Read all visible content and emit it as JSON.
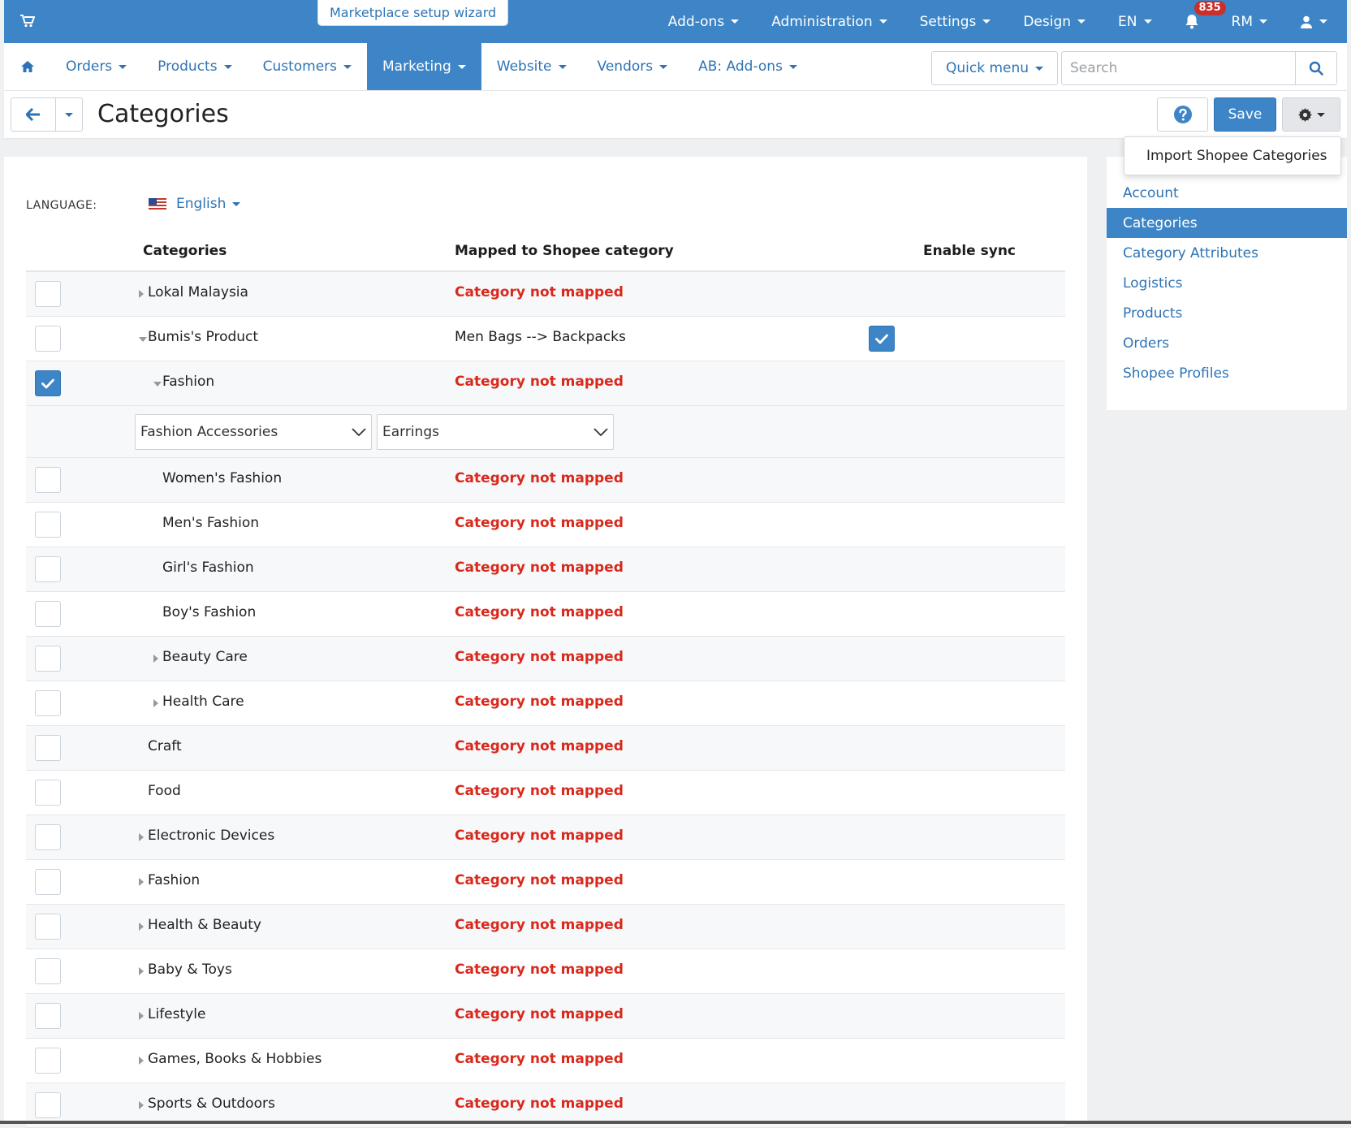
{
  "topbar": {
    "wizard_label": "Marketplace setup wizard",
    "menu": [
      "Add-ons",
      "Administration",
      "Settings",
      "Design",
      "EN"
    ],
    "notification_count": "835",
    "currency": "RM"
  },
  "nav": {
    "items": [
      "Orders",
      "Products",
      "Customers",
      "Marketing",
      "Website",
      "Vendors",
      "AB: Add-ons"
    ],
    "active": "Marketing",
    "quick_menu": "Quick menu",
    "search_placeholder": "Search"
  },
  "header": {
    "title": "Categories",
    "save_label": "Save",
    "dropdown_item": "Import Shopee Categories"
  },
  "language": {
    "label": "LANGUAGE:",
    "value": "English"
  },
  "table": {
    "columns": [
      "Categories",
      "Mapped to Shopee category",
      "Enable sync"
    ],
    "rows": [
      {
        "name": "Lokal Malaysia",
        "mapped": "Category not mapped",
        "level": 0,
        "toggle": "right",
        "checked": false
      },
      {
        "name": "Bumis's Product",
        "mapped": "Men Bags --> Backpacks",
        "level": 0,
        "toggle": "down",
        "checked": false,
        "sync": true
      },
      {
        "name": "Fashion",
        "mapped": "Category not mapped",
        "level": 1,
        "toggle": "down",
        "checked": true
      },
      {
        "name": "Women's Fashion",
        "mapped": "Category not mapped",
        "level": 2,
        "toggle": "none",
        "checked": false
      },
      {
        "name": "Men's Fashion",
        "mapped": "Category not mapped",
        "level": 2,
        "toggle": "none",
        "checked": false
      },
      {
        "name": "Girl's Fashion",
        "mapped": "Category not mapped",
        "level": 2,
        "toggle": "none",
        "checked": false
      },
      {
        "name": "Boy's Fashion",
        "mapped": "Category not mapped",
        "level": 2,
        "toggle": "none",
        "checked": false
      },
      {
        "name": "Beauty Care",
        "mapped": "Category not mapped",
        "level": 1,
        "toggle": "right",
        "checked": false
      },
      {
        "name": "Health Care",
        "mapped": "Category not mapped",
        "level": 1,
        "toggle": "right",
        "checked": false
      },
      {
        "name": "Craft",
        "mapped": "Category not mapped",
        "level": 0,
        "toggle": "none",
        "checked": false
      },
      {
        "name": "Food",
        "mapped": "Category not mapped",
        "level": 0,
        "toggle": "none",
        "checked": false
      },
      {
        "name": "Electronic Devices",
        "mapped": "Category not mapped",
        "level": 0,
        "toggle": "right",
        "checked": false
      },
      {
        "name": "Fashion",
        "mapped": "Category not mapped",
        "level": 0,
        "toggle": "right",
        "checked": false
      },
      {
        "name": "Health & Beauty",
        "mapped": "Category not mapped",
        "level": 0,
        "toggle": "right",
        "checked": false
      },
      {
        "name": "Baby & Toys",
        "mapped": "Category not mapped",
        "level": 0,
        "toggle": "right",
        "checked": false
      },
      {
        "name": "Lifestyle",
        "mapped": "Category not mapped",
        "level": 0,
        "toggle": "right",
        "checked": false
      },
      {
        "name": "Games, Books & Hobbies",
        "mapped": "Category not mapped",
        "level": 0,
        "toggle": "right",
        "checked": false
      },
      {
        "name": "Sports & Outdoors",
        "mapped": "Category not mapped",
        "level": 0,
        "toggle": "right",
        "checked": false
      }
    ],
    "mapping_selects": [
      "Fashion Accessories",
      "Earrings"
    ]
  },
  "sidebar": {
    "items": [
      "Account",
      "Categories",
      "Category Attributes",
      "Logistics",
      "Products",
      "Orders",
      "Shopee Profiles"
    ],
    "active": "Categories"
  },
  "colors": {
    "primary": "#3d85c6",
    "link": "#2e74b5",
    "not_mapped": "#d9291c",
    "badge": "#c9302c"
  }
}
